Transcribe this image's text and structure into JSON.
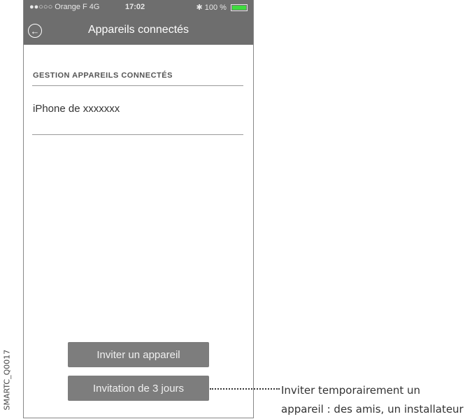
{
  "side_code": "SMARTC_Q0017",
  "status_bar": {
    "carrier": "●●○○○ Orange F  4G",
    "time": "17:02",
    "battery": "✱ 100 %"
  },
  "header": {
    "title": "Appareils connectés"
  },
  "section": {
    "title": "GESTION APPAREILS CONNECTÉS",
    "items": [
      "iPhone de xxxxxxx"
    ]
  },
  "buttons": {
    "invite": "Inviter un appareil",
    "invite_temp": "Invitation de 3 jours"
  },
  "annotation": {
    "line1": "Inviter temporairement un",
    "line2": "appareil : des amis, un installateur"
  },
  "colors": {
    "header_bg": "#6e6e6e",
    "button_bg": "#7d7d7d",
    "battery_fill": "#3fdc3f"
  }
}
